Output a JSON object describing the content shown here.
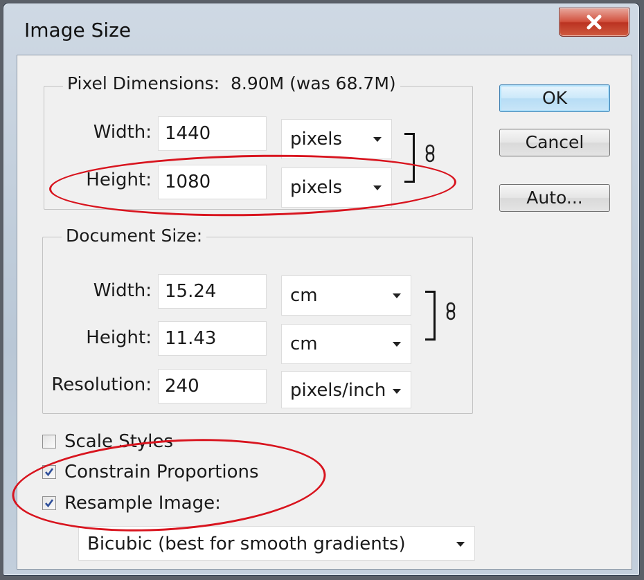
{
  "window": {
    "title": "Image Size"
  },
  "pixel_dimensions": {
    "label": "Pixel Dimensions:  8.90M (was 68.7M)",
    "width_label": "Width:",
    "width_value": "1440",
    "width_unit": "pixels",
    "height_label": "Height:",
    "height_value": "1080",
    "height_unit": "pixels"
  },
  "document_size": {
    "label": "Document Size:",
    "width_label": "Width:",
    "width_value": "15.24",
    "width_unit": "cm",
    "height_label": "Height:",
    "height_value": "11.43",
    "height_unit": "cm",
    "resolution_label": "Resolution:",
    "resolution_value": "240",
    "resolution_unit": "pixels/inch"
  },
  "buttons": {
    "ok": "OK",
    "cancel": "Cancel",
    "auto": "Auto..."
  },
  "options": {
    "scale_styles": {
      "label": "Scale Styles",
      "checked": false
    },
    "constrain_proportions": {
      "label": "Constrain Proportions",
      "checked": true
    },
    "resample_image": {
      "label": "Resample Image:",
      "checked": true
    },
    "resample_method": "Bicubic (best for smooth gradients)"
  },
  "colors": {
    "annotation_ellipse": "#d8141e",
    "default_button": "#cde9fa"
  },
  "icons": {
    "close": "close-icon",
    "link": "link-icon",
    "checkmark": "checkmark-icon",
    "dropdown": "chevron-down-icon"
  }
}
